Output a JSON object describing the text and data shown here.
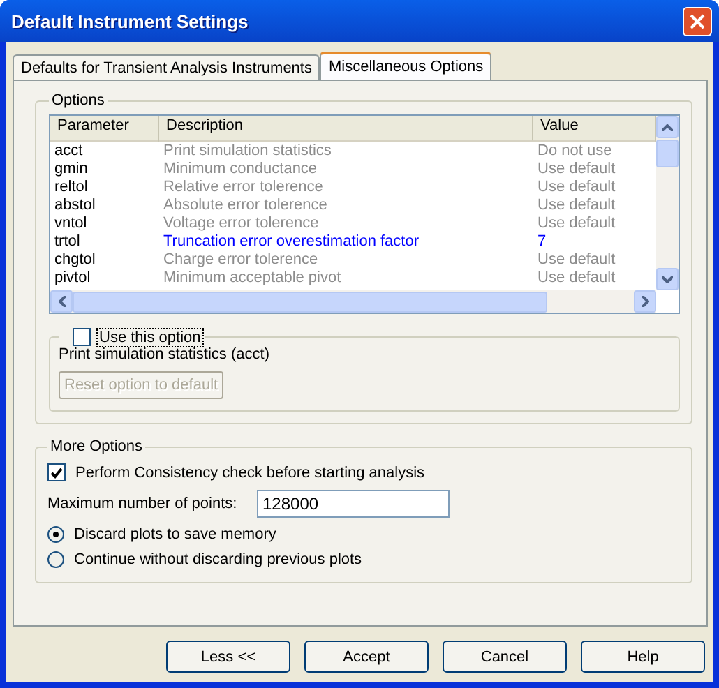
{
  "window": {
    "title": "Default Instrument Settings"
  },
  "tabs": [
    {
      "label": "Defaults for Transient Analysis Instruments",
      "selected": false
    },
    {
      "label": "Miscellaneous Options",
      "selected": true
    }
  ],
  "options": {
    "title": "Options",
    "table": {
      "columns": [
        "Parameter",
        "Description",
        "Value"
      ],
      "rows": [
        {
          "parameter": "acct",
          "description": "Print simulation statistics",
          "value": "Do not use",
          "modified": false
        },
        {
          "parameter": "gmin",
          "description": "Minimum conductance",
          "value": "Use default",
          "modified": false
        },
        {
          "parameter": "reltol",
          "description": "Relative error tolerence",
          "value": "Use default",
          "modified": false
        },
        {
          "parameter": "abstol",
          "description": "Absolute error tolerence",
          "value": "Use default",
          "modified": false
        },
        {
          "parameter": "vntol",
          "description": "Voltage error tolerence",
          "value": "Use default",
          "modified": false
        },
        {
          "parameter": "trtol",
          "description": "Truncation error overestimation factor",
          "value": "7",
          "modified": true
        },
        {
          "parameter": "chgtol",
          "description": "Charge error tolerence",
          "value": "Use default",
          "modified": false
        },
        {
          "parameter": "pivtol",
          "description": "Minimum acceptable pivot",
          "value": "Use default",
          "modified": false
        }
      ]
    },
    "use_option": {
      "label": "Use this option",
      "checked": false
    },
    "option_description": "Print simulation statistics (acct)",
    "reset_button": {
      "label": "Reset option to default",
      "disabled": true
    }
  },
  "more_options": {
    "title": "More Options",
    "consistency_check": {
      "label": "Perform Consistency check before starting analysis",
      "checked": true
    },
    "max_points": {
      "label": "Maximum number of points:",
      "value": "128000"
    },
    "radios": [
      {
        "label": "Discard plots to save memory",
        "selected": true
      },
      {
        "label": "Continue without discarding previous plots",
        "selected": false
      }
    ]
  },
  "buttons": [
    "Less <<",
    "Accept",
    "Cancel",
    "Help"
  ]
}
